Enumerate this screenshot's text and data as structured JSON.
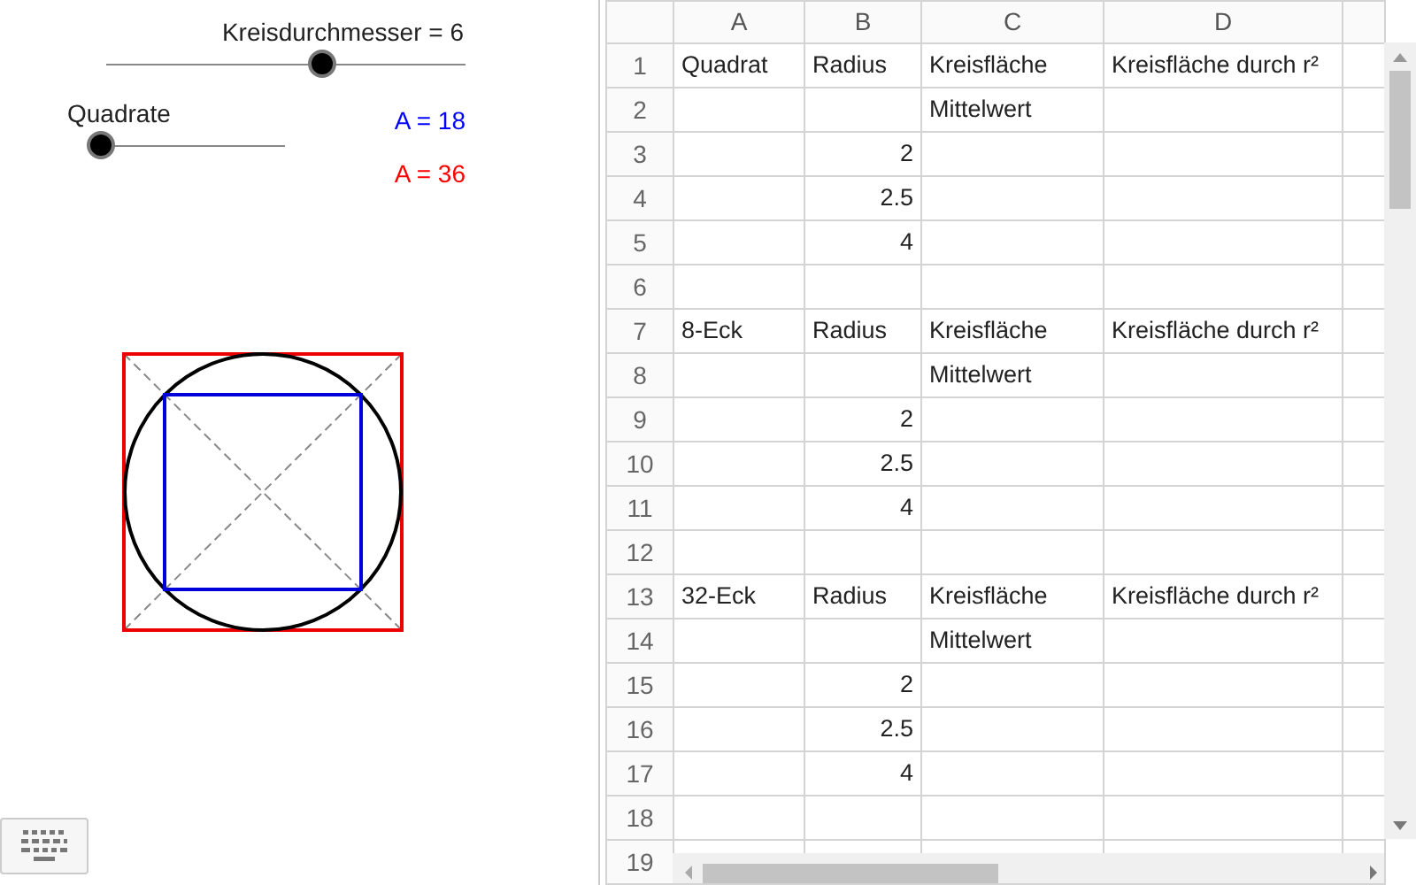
{
  "sliders": [
    {
      "label": "Kreisdurchmesser = 6",
      "level": 0.6
    },
    {
      "label": "Quadrate",
      "level": 0.04
    }
  ],
  "area_labels": [
    {
      "text": "A = 18",
      "color": "#0000ff"
    },
    {
      "text": "A = 36",
      "color": "#ff0000"
    }
  ],
  "spreadsheet": {
    "columns": [
      "A",
      "B",
      "C",
      "D"
    ],
    "rows": [
      {
        "number": "1",
        "cells": [
          {
            "text": "Quadrat",
            "kind": "text"
          },
          {
            "text": "Radius",
            "kind": "text"
          },
          {
            "text": "Kreisfläche",
            "kind": "text"
          },
          {
            "text": "Kreisfläche durch r²",
            "kind": "text"
          }
        ]
      },
      {
        "number": "2",
        "cells": [
          {
            "kind": "empty"
          },
          {
            "kind": "empty"
          },
          {
            "text": "Mittelwert",
            "kind": "text"
          },
          {
            "kind": "empty"
          }
        ]
      },
      {
        "number": "3",
        "cells": [
          {
            "kind": "empty"
          },
          {
            "text": "2",
            "kind": "number"
          },
          {
            "kind": "empty"
          },
          {
            "kind": "empty"
          }
        ]
      },
      {
        "number": "4",
        "cells": [
          {
            "kind": "empty"
          },
          {
            "text": "2.5",
            "kind": "number"
          },
          {
            "kind": "empty"
          },
          {
            "kind": "empty"
          }
        ]
      },
      {
        "number": "5",
        "cells": [
          {
            "kind": "empty"
          },
          {
            "text": "4",
            "kind": "number"
          },
          {
            "kind": "empty"
          },
          {
            "kind": "empty"
          }
        ]
      },
      {
        "number": "6",
        "cells": [
          {
            "kind": "empty"
          },
          {
            "kind": "empty"
          },
          {
            "kind": "empty"
          },
          {
            "kind": "empty"
          }
        ]
      },
      {
        "number": "7",
        "cells": [
          {
            "text": "8-Eck",
            "kind": "text"
          },
          {
            "text": "Radius",
            "kind": "text"
          },
          {
            "text": "Kreisfläche",
            "kind": "text"
          },
          {
            "text": "Kreisfläche durch r²",
            "kind": "text"
          }
        ]
      },
      {
        "number": "8",
        "cells": [
          {
            "kind": "empty"
          },
          {
            "kind": "empty"
          },
          {
            "text": "Mittelwert",
            "kind": "text"
          },
          {
            "kind": "empty"
          }
        ]
      },
      {
        "number": "9",
        "cells": [
          {
            "kind": "empty"
          },
          {
            "text": "2",
            "kind": "number"
          },
          {
            "kind": "empty"
          },
          {
            "kind": "empty"
          }
        ]
      },
      {
        "number": "10",
        "cells": [
          {
            "kind": "empty"
          },
          {
            "text": "2.5",
            "kind": "number"
          },
          {
            "kind": "empty"
          },
          {
            "kind": "empty"
          }
        ]
      },
      {
        "number": "11",
        "cells": [
          {
            "kind": "empty"
          },
          {
            "text": "4",
            "kind": "number"
          },
          {
            "kind": "empty"
          },
          {
            "kind": "empty"
          }
        ]
      },
      {
        "number": "12",
        "cells": [
          {
            "kind": "empty"
          },
          {
            "kind": "empty"
          },
          {
            "kind": "empty"
          },
          {
            "kind": "empty"
          }
        ]
      },
      {
        "number": "13",
        "cells": [
          {
            "text": "32-Eck",
            "kind": "text"
          },
          {
            "text": "Radius",
            "kind": "text"
          },
          {
            "text": "Kreisfläche",
            "kind": "text"
          },
          {
            "text": "Kreisfläche durch r²",
            "kind": "text"
          }
        ]
      },
      {
        "number": "14",
        "cells": [
          {
            "kind": "empty"
          },
          {
            "kind": "empty"
          },
          {
            "text": "Mittelwert",
            "kind": "text"
          },
          {
            "kind": "empty"
          }
        ]
      },
      {
        "number": "15",
        "cells": [
          {
            "kind": "empty"
          },
          {
            "text": "2",
            "kind": "number"
          },
          {
            "kind": "empty"
          },
          {
            "kind": "empty"
          }
        ]
      },
      {
        "number": "16",
        "cells": [
          {
            "kind": "empty"
          },
          {
            "text": "2.5",
            "kind": "number"
          },
          {
            "kind": "empty"
          },
          {
            "kind": "empty"
          }
        ]
      },
      {
        "number": "17",
        "cells": [
          {
            "kind": "empty"
          },
          {
            "text": "4",
            "kind": "number"
          },
          {
            "kind": "empty"
          },
          {
            "kind": "empty"
          }
        ]
      },
      {
        "number": "18",
        "cells": [
          {
            "kind": "empty"
          },
          {
            "kind": "empty"
          },
          {
            "kind": "empty"
          },
          {
            "kind": "empty"
          }
        ]
      },
      {
        "number": "19",
        "cells": [
          {
            "kind": "empty"
          },
          {
            "kind": "empty"
          },
          {
            "kind": "empty"
          },
          {
            "kind": "empty"
          }
        ]
      }
    ]
  }
}
